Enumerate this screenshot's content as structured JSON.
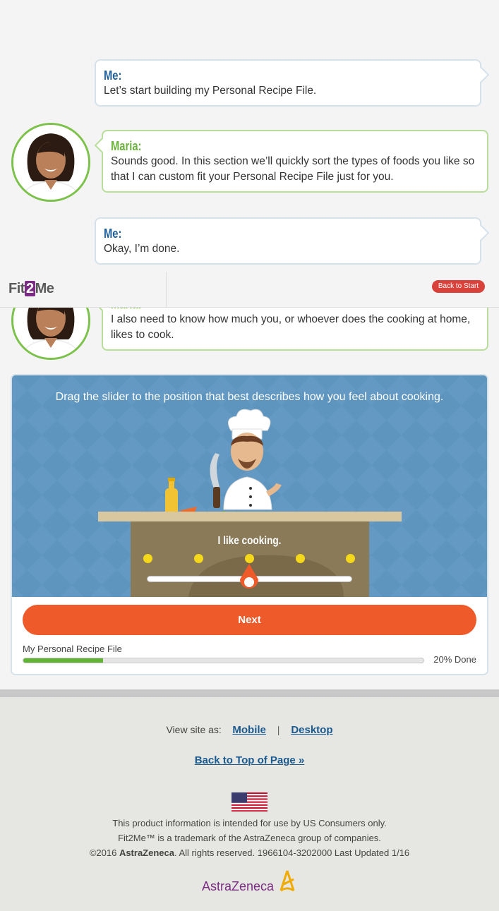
{
  "chat": [
    {
      "speaker": "Me:",
      "text": "Let’s start building my Personal Recipe File."
    },
    {
      "speaker": "Maria:",
      "text": "Sounds good. In this section we’ll quickly sort the types of foods you like so that I can custom fit your Personal Recipe File just for you."
    },
    {
      "speaker": "Me:",
      "text": "Okay, I’m done."
    },
    {
      "speaker": "Maria:",
      "text": "I also need to know how much you, or whoever does the cooking at home, likes to cook."
    }
  ],
  "header": {
    "logo_pre": "Fit",
    "logo_num": "2",
    "logo_post": "Me",
    "back_label": "Back to Start"
  },
  "activity": {
    "instruction": "Drag the slider to the position that best describes how you feel about cooking.",
    "slider_label": "I like cooking.",
    "slider_positions": 5,
    "slider_value": 3,
    "next_label": "Next",
    "progress_label": "My Personal Recipe File",
    "progress_fraction": 0.2,
    "progress_text": "20% Done"
  },
  "footer": {
    "view_as": "View site as:",
    "mobile": "Mobile",
    "separator": "|",
    "desktop": "Desktop",
    "back_to_top": "Back to Top of Page »",
    "legal_1": "This product information is intended for use by US Consumers only.",
    "legal_2": "Fit2Me™ is a trademark of the AstraZeneca group of companies.",
    "legal_3_pre": "©2016 ",
    "legal_3_brand": "AstraZeneca",
    "legal_3_post": ". All rights reserved. 1966104-3202000 Last Updated 1/16",
    "brand_logo": "AstraZeneca"
  },
  "colors": {
    "accent": "#ef5a2a",
    "maria": "#6db33f",
    "me": "#1f5f9a",
    "progress": "#5fb532",
    "scene": "#5d95bf"
  }
}
